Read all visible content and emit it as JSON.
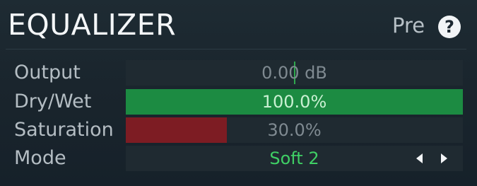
{
  "header": {
    "title": "EQUALIZER",
    "pre_label": "Pre",
    "help_label": "?"
  },
  "rows": {
    "output": {
      "label": "Output",
      "value": "0.00 dB"
    },
    "drywet": {
      "label": "Dry/Wet",
      "value": "100.0%",
      "level": 1.0
    },
    "saturation": {
      "label": "Saturation",
      "value": "30.0%",
      "level": 0.3
    },
    "mode": {
      "label": "Mode",
      "value": "Soft 2"
    }
  },
  "icons": {
    "mode_prev": "triangle-left-icon",
    "mode_next": "triangle-right-icon",
    "help": "question-mark-icon"
  },
  "colors": {
    "green_fill": "#1c8b42",
    "red_fill": "#7d1c23",
    "value_text_dim": "#7f8a91",
    "value_text_light": "#c9f0d2",
    "mode_text": "#3fcf65"
  }
}
